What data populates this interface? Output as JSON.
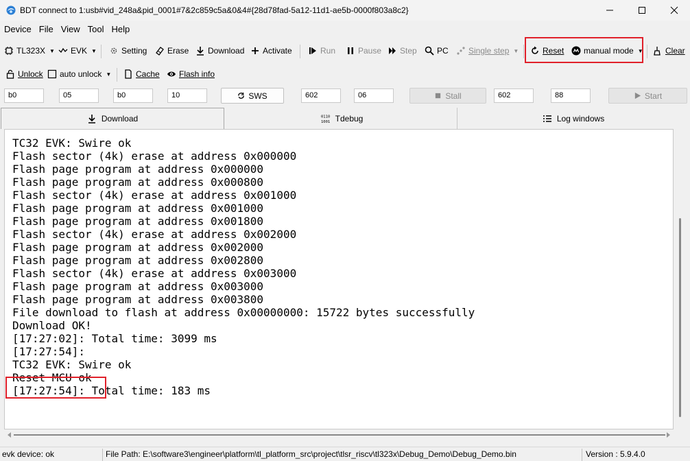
{
  "window": {
    "title": "BDT connect to 1:usb#vid_248a&pid_0001#7&2c859c5a&0&4#{28d78fad-5a12-11d1-ae5b-0000f803a8c2}"
  },
  "menu": [
    "Device",
    "File",
    "View",
    "Tool",
    "Help"
  ],
  "toolbar1": {
    "chip": "TL323X",
    "board": "EVK",
    "setting": "Setting",
    "erase": "Erase",
    "download": "Download",
    "activate": "Activate",
    "run": "Run",
    "pause": "Pause",
    "step": "Step",
    "pc": "PC",
    "single_step": "Single step",
    "reset": "Reset",
    "mode": "manual mode",
    "clear": "Clear"
  },
  "toolbar2": {
    "unlock": "Unlock",
    "auto_unlock": "auto unlock",
    "cache": "Cache",
    "flash_info": "Flash info"
  },
  "swire_row": {
    "fields": [
      "b0",
      "05",
      "b0",
      "10",
      "602",
      "06",
      "602",
      "88"
    ],
    "sws_label": "SWS",
    "stall_label": "Stall",
    "start_label": "Start"
  },
  "tabs": [
    "Download",
    "Tdebug",
    "Log windows"
  ],
  "log": [
    "TC32 EVK: Swire ok",
    "Flash sector (4k) erase at address 0x000000",
    "Flash page program at address 0x000000",
    "Flash page program at address 0x000800",
    "Flash sector (4k) erase at address 0x001000",
    "Flash page program at address 0x001000",
    "Flash page program at address 0x001800",
    "Flash sector (4k) erase at address 0x002000",
    "Flash page program at address 0x002000",
    "Flash page program at address 0x002800",
    "Flash sector (4k) erase at address 0x003000",
    "Flash page program at address 0x003000",
    "Flash page program at address 0x003800",
    "File download to flash at address 0x00000000: 15722 bytes successfully",
    "Download OK!",
    "[17:27:02]: Total time: 3099 ms",
    "",
    "[17:27:54]:",
    "TC32 EVK: Swire ok",
    "Reset MCU ok",
    "[17:27:54]: Total time: 183 ms"
  ],
  "status": {
    "device": "evk device: ok",
    "file_path": "File Path:  E:\\software3\\engineer\\platform\\tl_platform_src\\project\\tlsr_riscv\\tl323x\\Debug_Demo\\Debug_Demo.bin",
    "version": "Version : 5.9.4.0"
  },
  "colors": {
    "highlight_box": "#e0202a"
  }
}
